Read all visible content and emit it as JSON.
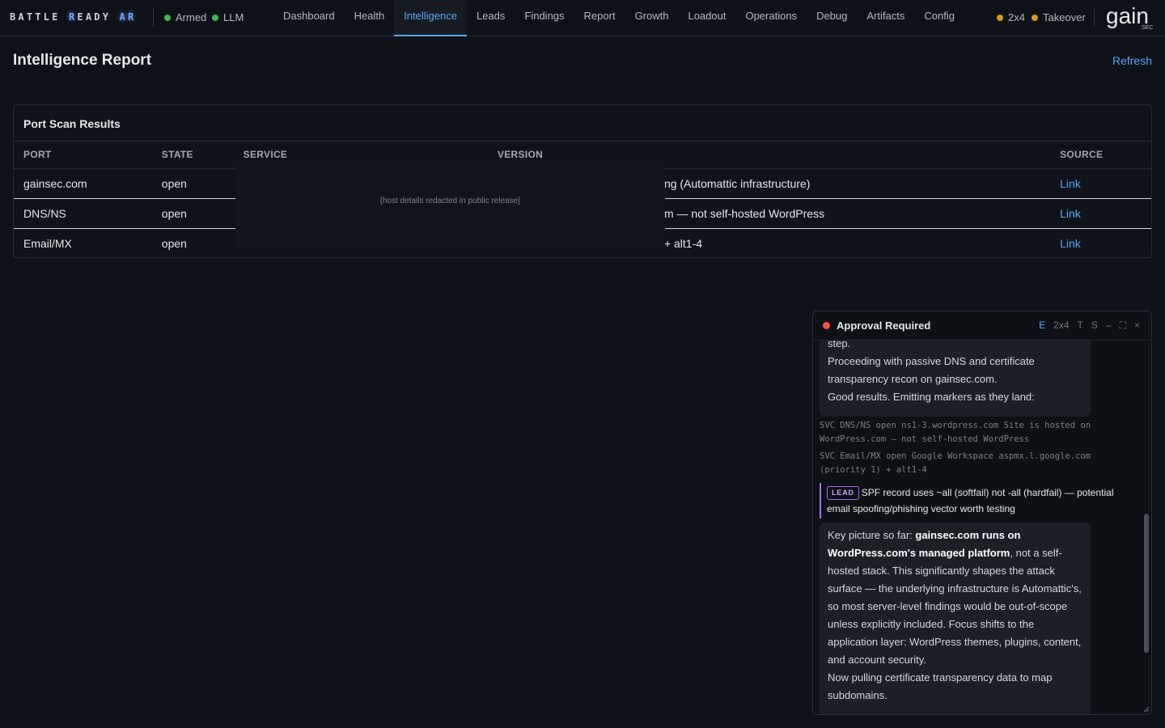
{
  "brand": {
    "part1": "BATTLE ",
    "hl1": "R",
    "part2": "EADY ",
    "hl2": "A",
    "part3": "R"
  },
  "status_left": [
    {
      "label": "Armed",
      "color": "#3fb950"
    },
    {
      "label": "LLM",
      "color": "#3fb950"
    }
  ],
  "nav": {
    "items": [
      "Dashboard",
      "Health",
      "Intelligence",
      "Leads",
      "Findings",
      "Report",
      "Growth",
      "Loadout",
      "Operations",
      "Debug",
      "Artifacts",
      "Config"
    ],
    "active": "Intelligence"
  },
  "status_right": [
    {
      "label": "2x4",
      "color": "#d29922"
    },
    {
      "label": "Takeover",
      "color": "#d29922"
    }
  ],
  "logo": {
    "main": "gain",
    "sub": "SEC"
  },
  "page": {
    "title": "Intelligence Report",
    "refresh": "Refresh"
  },
  "port_scan": {
    "title": "Port Scan Results",
    "columns": [
      "PORT",
      "STATE",
      "SERVICE",
      "VERSION",
      "SOURCE"
    ],
    "rows": [
      {
        "port": "gainsec.com",
        "state": "open",
        "service": "",
        "version": "ng (Automattic infrastructure)",
        "source": "Link"
      },
      {
        "port": "DNS/NS",
        "state": "open",
        "service": "",
        "version": "m — not self-hosted WordPress",
        "source": "Link"
      },
      {
        "port": "Email/MX",
        "state": "open",
        "service": "",
        "version": "+ alt1-4",
        "source": "Link"
      }
    ],
    "redaction_note": "[host details redacted in public release]"
  },
  "approval_panel": {
    "title": "Approval Required",
    "controls": [
      "E",
      "2x4",
      "T",
      "S",
      "–",
      "⛶",
      "×"
    ],
    "active_control": "E",
    "bubble1": [
      "step.",
      "Proceeding with passive DNS and certificate transparency recon on gainsec.com.",
      "Good results. Emitting markers as they land:"
    ],
    "svc_lines": [
      "SVC DNS/NS open ns1-3.wordpress.com Site is hosted on WordPress.com — not self-hosted WordPress",
      "SVC Email/MX open Google Workspace aspmx.l.google.com (priority 1) + alt1-4"
    ],
    "lead": {
      "badge": "LEAD",
      "text": "SPF record uses ~all (softfail) not -all (hardfail) — potential email spoofing/phishing vector worth testing"
    },
    "bubble2": {
      "prefix": "Key picture so far: ",
      "bold": "gainsec.com runs on WordPress.com's managed platform",
      "rest": ", not a self-hosted stack. This significantly shapes the attack surface — the underlying infrastructure is Automattic's, so most server-level findings would be out-of-scope unless explicitly included. Focus shifts to the application layer: WordPress themes, plugins, content, and account security.",
      "line2": "Now pulling certificate transparency data to map subdomains."
    }
  }
}
